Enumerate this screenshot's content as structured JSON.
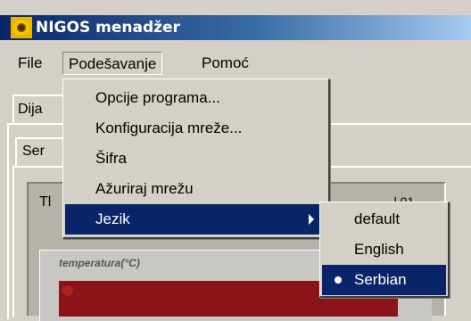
{
  "window": {
    "title": "NIGOS menadžer",
    "icon": "sunflower-icon"
  },
  "menubar": {
    "items": [
      "File",
      "Podešavanje",
      "Pomoć"
    ]
  },
  "tabs": {
    "outer_tab": "Dija",
    "inner_tab": "Ser"
  },
  "group": {
    "label": "Tl",
    "right_fragment": "...l 01"
  },
  "chart": {
    "title": "temperatura(°C)",
    "plot_color": "#8b1418"
  },
  "podesavanje_menu": {
    "items": [
      {
        "label": "Opcije programa..."
      },
      {
        "label": "Konfiguracija mreže..."
      },
      {
        "label": "Šifra"
      },
      {
        "label": "Ažuriraj mrežu"
      },
      {
        "label": "Jezik",
        "submenu": true
      }
    ]
  },
  "jezik_submenu": {
    "items": [
      {
        "label": "default"
      },
      {
        "label": "English"
      },
      {
        "label": "Serbian",
        "selected": true
      }
    ]
  },
  "colors": {
    "highlight": "#0a246a",
    "face": "#d4d0c8"
  }
}
